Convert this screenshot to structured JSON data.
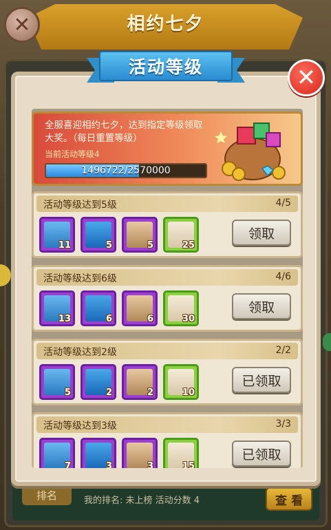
{
  "background": {
    "title": "相约七夕",
    "rank_button": "排名",
    "rank_text": "我的排名: 未上榜   活动分数  4",
    "look_button": "查 看"
  },
  "modal": {
    "title": "活动等级",
    "description": "全服喜迎相约七夕，达到指定等级领取大奖。（每日重置等级）",
    "current_level_label": "当前活动等级4",
    "progress_text": "1496722/2570000",
    "progress_fraction": 0.5824
  },
  "rows": [
    {
      "title": "活动等级达到5级",
      "count": "4/5",
      "button": "领取",
      "items": [
        {
          "icon": "worker-card-icon",
          "qty": "11",
          "rarity": "purple"
        },
        {
          "icon": "coin-wings-icon",
          "qty": "5",
          "rarity": "purple"
        },
        {
          "icon": "hand-coin-icon",
          "qty": "5",
          "rarity": "purple"
        },
        {
          "icon": "flower-fan-icon",
          "qty": "25",
          "rarity": "green"
        }
      ]
    },
    {
      "title": "活动等级达到6级",
      "count": "4/6",
      "button": "领取",
      "items": [
        {
          "icon": "worker-card-icon",
          "qty": "13",
          "rarity": "purple"
        },
        {
          "icon": "coin-wings-icon",
          "qty": "6",
          "rarity": "purple"
        },
        {
          "icon": "hand-coin-icon",
          "qty": "6",
          "rarity": "purple"
        },
        {
          "icon": "flower-fan-icon",
          "qty": "30",
          "rarity": "green"
        }
      ]
    },
    {
      "title": "活动等级达到2级",
      "count": "2/2",
      "button": "已领取",
      "items": [
        {
          "icon": "worker-card-icon",
          "qty": "5",
          "rarity": "purple"
        },
        {
          "icon": "coin-wings-icon",
          "qty": "2",
          "rarity": "purple"
        },
        {
          "icon": "hand-coin-icon",
          "qty": "2",
          "rarity": "purple"
        },
        {
          "icon": "flower-fan-icon",
          "qty": "10",
          "rarity": "green"
        }
      ]
    },
    {
      "title": "活动等级达到3级",
      "count": "3/3",
      "button": "已领取",
      "items": [
        {
          "icon": "worker-card-icon",
          "qty": "7",
          "rarity": "purple"
        },
        {
          "icon": "coin-wings-icon",
          "qty": "3",
          "rarity": "purple"
        },
        {
          "icon": "hand-coin-icon",
          "qty": "3",
          "rarity": "purple"
        },
        {
          "icon": "flower-fan-icon",
          "qty": "15",
          "rarity": "green"
        }
      ]
    }
  ]
}
